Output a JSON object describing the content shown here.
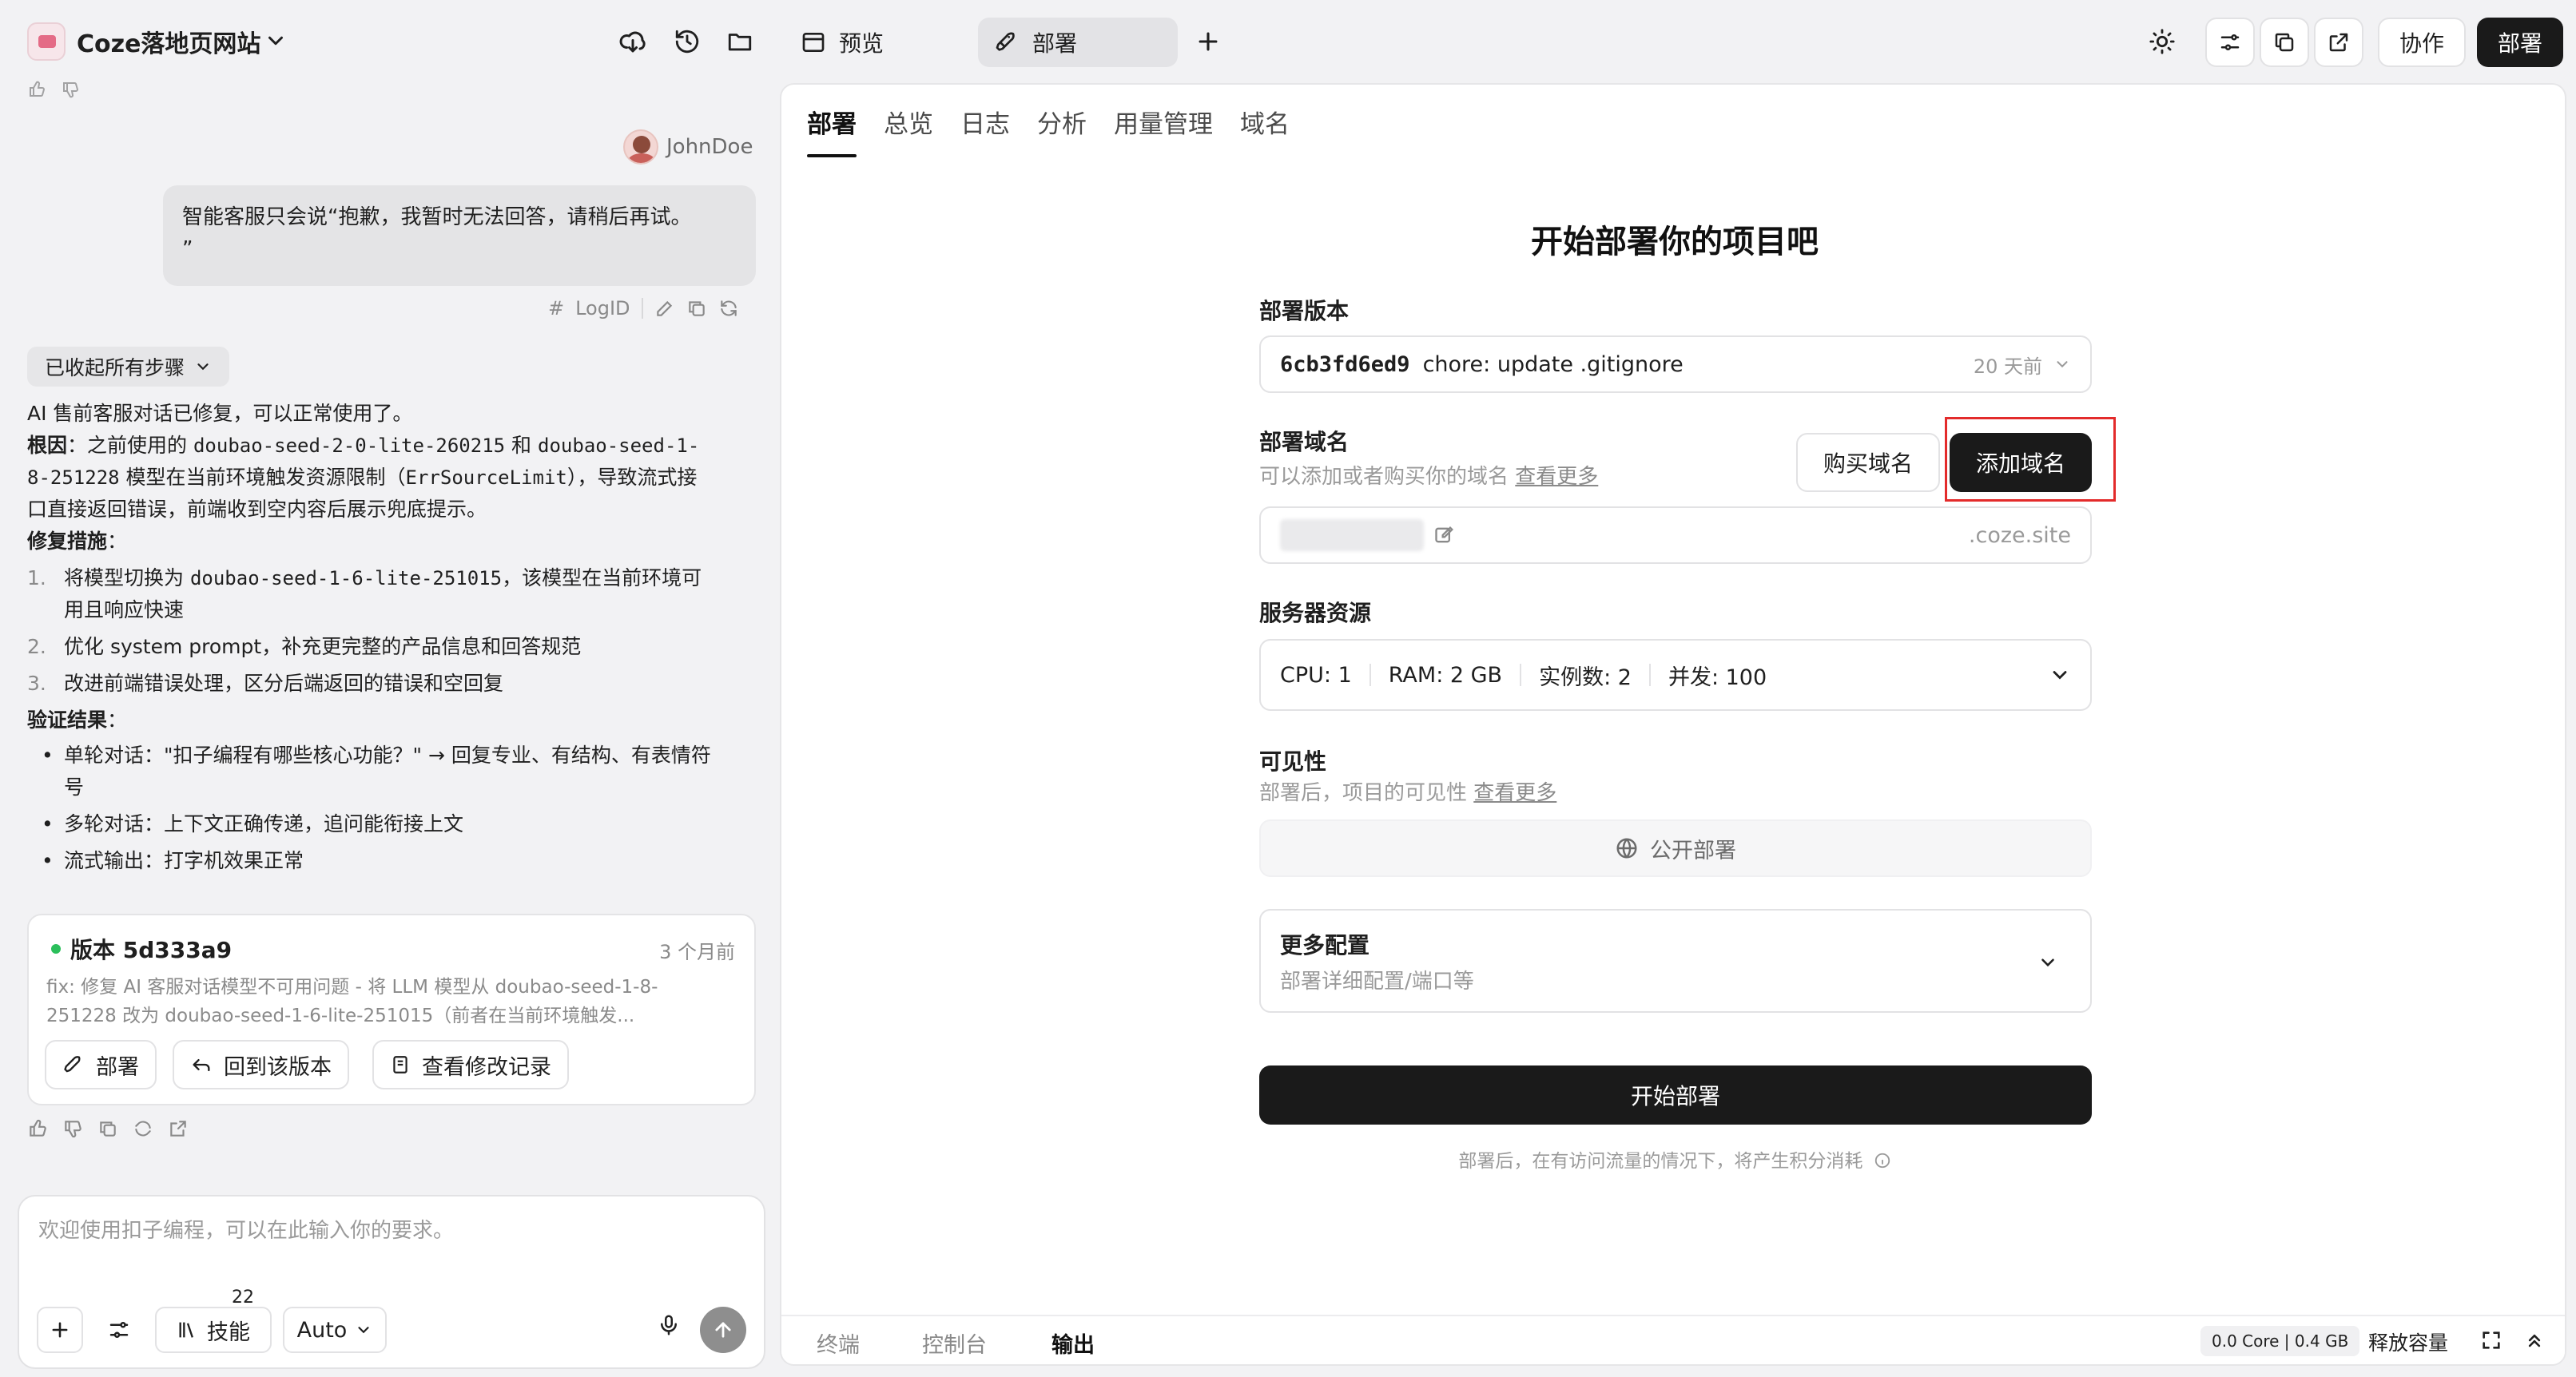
{
  "app": {
    "title": "Coze落地页网站"
  },
  "top_tabs": [
    {
      "label": "预览",
      "active": false
    },
    {
      "label": "部署",
      "active": true
    }
  ],
  "top_actions": {
    "collab_label": "协作",
    "deploy_label": "部署"
  },
  "chat": {
    "username": "JohnDoe",
    "user_message_line1": "智能客服只会说“抱歉，我暂时无法回答，请稍后再试。",
    "user_message_line2": "”",
    "logid_label": "LogID",
    "steps_pill": "已收起所有步骤",
    "reply": {
      "intro": "AI 售前客服对话已修复，可以正常使用了。",
      "root_cause_label": "根因",
      "root_cause_a": "：之前使用的 ",
      "root_cause_model_1": "doubao-seed-2-0-lite-260215",
      "root_cause_b": " 和 ",
      "root_cause_model_2a": "doubao-seed-1-",
      "root_cause_model_2b": "8-251228",
      "root_cause_c": " 模型在当前环境触发资源限制（",
      "root_cause_err": "ErrSourceLimit",
      "root_cause_d": "），导致流式接",
      "root_cause_e": "口直接返回错误，前端收到空内容后展示兜底提示。",
      "fix_label": "修复措施",
      "fix_items": [
        {
          "num": "1.",
          "a": "将模型切换为 ",
          "code": "doubao-seed-1-6-lite-251015",
          "b": "，该模型在当前环境可",
          "cont": "用且响应快速"
        },
        {
          "num": "2.",
          "a": "优化 system prompt，补充更完整的产品信息和回答规范"
        },
        {
          "num": "3.",
          "a": "改进前端错误处理，区分后端返回的错误和空回复"
        }
      ],
      "verify_label": "验证结果",
      "verify_items": [
        {
          "text": "单轮对话：\"扣子编程有哪些核心功能？\" → 回复专业、有结构、有表情符",
          "cont": "号"
        },
        {
          "text": "多轮对话：上下文正确传递，追问能衔接上文"
        },
        {
          "text": "流式输出：打字机效果正常"
        }
      ]
    },
    "version_card": {
      "name": "版本 5d333a9",
      "time": "3 个月前",
      "desc_line1": "fix: 修复 AI 客服对话模型不可用问题 - 将 LLM 模型从 doubao-seed-1-8-",
      "desc_line2": "251228 改为 doubao-seed-1-6-lite-251015（前者在当前环境触发...",
      "btn_deploy": "部署",
      "btn_rollback": "回到该版本",
      "btn_changes": "查看修改记录"
    },
    "input": {
      "placeholder": "欢迎使用扣子编程，可以在此输入你的要求。",
      "skills_label": "技能",
      "skills_count": "22",
      "mode_label": "Auto"
    }
  },
  "deploy": {
    "tabs": [
      "部署",
      "总览",
      "日志",
      "分析",
      "用量管理",
      "域名"
    ],
    "title": "开始部署你的项目吧",
    "version_label": "部署版本",
    "version_hash": "6cb3fd6ed9",
    "version_msg": "chore: update .gitignore",
    "version_time": "20 天前",
    "domain_label": "部署域名",
    "domain_hint": "可以添加或者购买你的域名",
    "see_more": "查看更多",
    "buy_domain": "购买域名",
    "add_domain": "添加域名",
    "domain_suffix": ".coze.site",
    "server_label": "服务器资源",
    "server_cpu": "CPU: 1",
    "server_ram": "RAM: 2 GB",
    "server_instances": "实例数: 2",
    "server_concurrency": "并发: 100",
    "visibility_label": "可见性",
    "visibility_hint": "部署后，项目的可见性",
    "visibility_value": "公开部署",
    "more_config_title": "更多配置",
    "more_config_hint": "部署详细配置/端口等",
    "start_deploy": "开始部署",
    "footer_note": "部署后，在有访问流量的情况下，将产生积分消耗"
  },
  "bottom_bar": {
    "tabs": [
      "终端",
      "控制台",
      "输出"
    ],
    "core": "0.0 Core | 0.4 GB",
    "release": "释放容量"
  },
  "colors": {
    "accent_dark": "#1a1a1a",
    "highlight_red": "#e32b2b",
    "status_green": "#2bbf5b"
  }
}
